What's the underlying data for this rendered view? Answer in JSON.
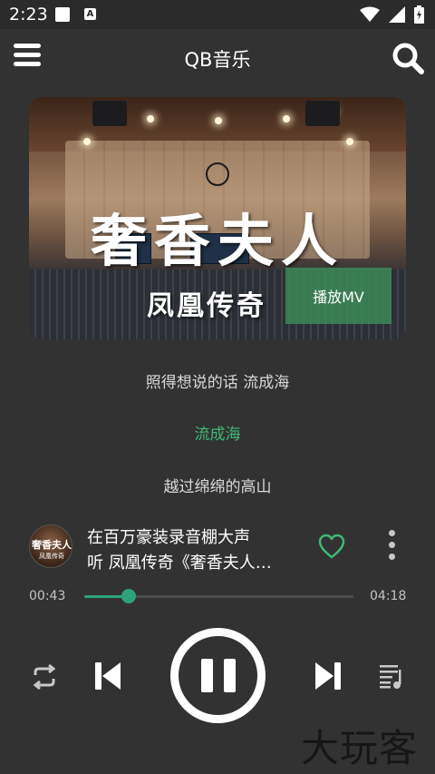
{
  "status_bar": {
    "time": "2:23",
    "notification_a": "A"
  },
  "app_bar": {
    "title": "QB音乐"
  },
  "cover": {
    "title": "奢香夫人",
    "subtitle": "凤凰传奇",
    "mv_button": "播放MV"
  },
  "lyrics": {
    "previous": "照得想说的话 流成海",
    "current": "流成海",
    "next": "越过绵绵的高山"
  },
  "now_playing": {
    "thumb_title": "奢香夫人",
    "thumb_subtitle": "凤凰传奇",
    "line1": "在百万豪装录音棚大声",
    "line2": "听 凤凰传奇《奢香夫人…",
    "liked": false
  },
  "progress": {
    "current_time": "00:43",
    "total_time": "04:18",
    "fraction": 0.166
  },
  "controls": {
    "repeat": "repeat-icon",
    "previous": "skip-previous-icon",
    "play_pause": "pause-icon",
    "next": "skip-next-icon",
    "queue": "playlist-icon"
  },
  "colors": {
    "accent": "#3dba74",
    "background": "#323232",
    "progress": "#2ea37a"
  },
  "watermark": "大玩客"
}
